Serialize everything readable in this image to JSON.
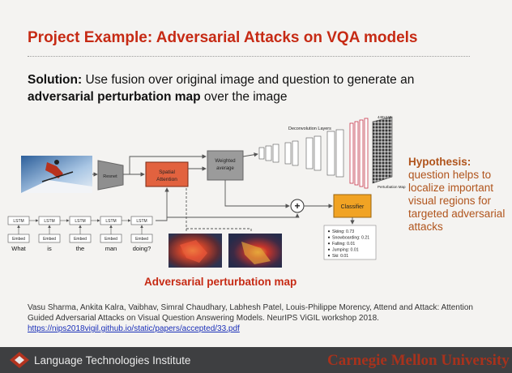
{
  "slide": {
    "title": "Project Example: Adversarial Attacks on VQA models",
    "solution_label": "Solution:",
    "solution_text_1": " Use fusion over original image and question to generate an",
    "solution_bold_2": "adversarial perturbation map",
    "solution_text_2": " over the image"
  },
  "diagram": {
    "resnet": "Resnet",
    "spatial_attention_1": "Spatial",
    "spatial_attention_2": "Attention",
    "weighted_avg_1": "Weighted",
    "weighted_avg_2": "average",
    "deconv_label": "Deconvolution Layers",
    "perturbation_map_label": "Perturbation Map",
    "size_top": "448x448",
    "classifier": "Classifier",
    "plus": "+",
    "lstm_label": "LSTM",
    "embed_label": "Embed",
    "words": [
      "What",
      "is",
      "the",
      "man",
      "doing?"
    ],
    "predictions": [
      "Skiing: 0.73",
      "Snowboarding: 0.21",
      "Falling: 0.01",
      "Jumping: 0.01",
      "Ski: 0.01"
    ]
  },
  "hypothesis": {
    "heading": "Hypothesis:",
    "body": "question helps to localize important visual regions for targeted adversarial attacks"
  },
  "perturbation_caption": "Adversarial perturbation map",
  "citation": {
    "text": "Vasu Sharma, Ankita Kalra, Vaibhav, Simral Chaudhary, Labhesh Patel, Louis-Philippe Morency, Attend and Attack: Attention Guided Adversarial Attacks on Visual Question Answering Models. NeurIPS ViGIL workshop 2018.",
    "link": "https://nips2018vigil.github.io/static/papers/accepted/33.pdf"
  },
  "footer": {
    "institute": "Language Technologies Institute",
    "university": "Carnegie Mellon University"
  },
  "colors": {
    "title_red": "#c62a14",
    "hypothesis_orange": "#b0541c",
    "spatial_attention_fill": "#e2623f",
    "classifier_fill": "#f1a324",
    "footer_bg": "#3e3f41"
  }
}
